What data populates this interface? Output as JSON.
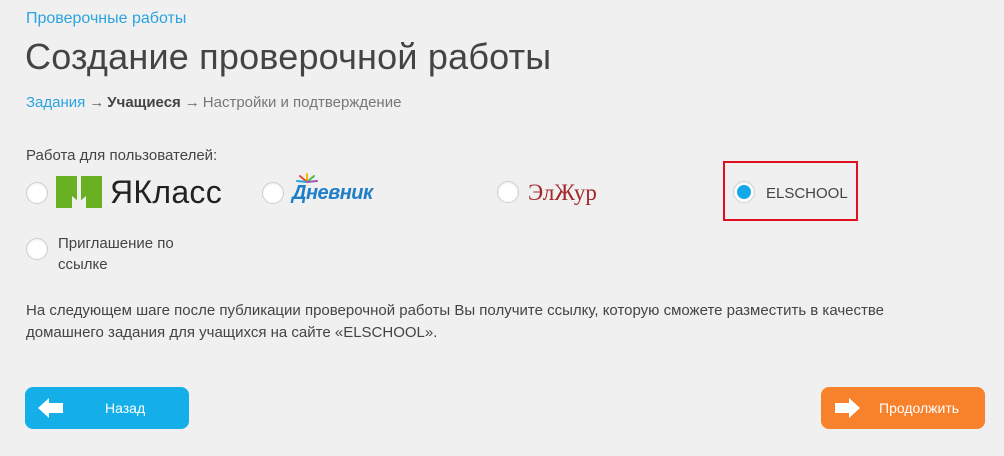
{
  "top_link": "Проверочные работы",
  "page_title": "Создание проверочной работы",
  "breadcrumbs": {
    "step1": "Задания",
    "step2": "Учащиеся",
    "step3": "Настройки и подтверждение",
    "arrow": "→"
  },
  "audience": {
    "label": "Работа для пользователей:",
    "options": {
      "yaklass": {
        "logo_text": "ЯКласс",
        "selected": false
      },
      "dnevnik": {
        "logo_text": "Дневник",
        "selected": false
      },
      "elzhur": {
        "logo_text": "ЭлЖур",
        "selected": false
      },
      "elschool": {
        "label": "ELSCHOOL",
        "selected": true
      },
      "invite": {
        "label": "Приглашение по ссылке",
        "selected": false
      }
    }
  },
  "notice": "На следующем шаге после публикации проверочной работы Вы получите ссылку, которую сможете разместить в качестве домашнего задания для учащихся на сайте «ELSCHOOL».",
  "buttons": {
    "back": "Назад",
    "next": "Продолжить"
  },
  "colors": {
    "accent_blue": "#14aee8",
    "accent_orange": "#f7822b",
    "highlight_red": "#e10f1f",
    "link_blue": "#2aa4e0",
    "yaklass_green": "#6ab023",
    "elzhur_red": "#a32727"
  }
}
